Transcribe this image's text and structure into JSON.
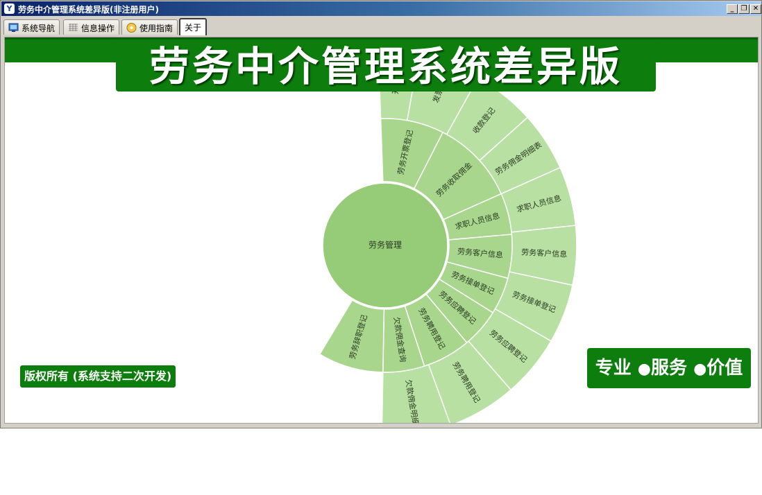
{
  "window": {
    "title": "劳务中介管理系统差异版(非注册用户)",
    "app_icon_glyph": "Y",
    "minimize_glyph": "_",
    "restore_glyph": "❐",
    "close_glyph": "✕"
  },
  "tabs": [
    {
      "label": "系统导航",
      "icon": "monitor-icon"
    },
    {
      "label": "信息操作",
      "icon": "grid-icon"
    },
    {
      "label": "使用指南",
      "icon": "help-disc-icon"
    },
    {
      "label": "关于",
      "icon": "",
      "active": true
    }
  ],
  "header": {
    "title": "劳务中介管理系统差异版"
  },
  "copyright": "版权所有 (系统支持二次开发)",
  "slogan": {
    "item1": "专业",
    "item2": "服务",
    "item3": "价值",
    "bullet": "●"
  },
  "colors": {
    "brand_green": "#0d7d0d",
    "core_green": "#96cb78",
    "ring1_green": "#a9d68d",
    "ring2_green": "#b8e0a2"
  },
  "sunburst": {
    "center": "劳务管理",
    "ring1": [
      "劳务开票登记",
      "劳务收取佣金",
      "求职人员信息",
      "劳务客户信息",
      "劳务接单登记",
      "劳务应聘登记",
      "劳务聘用登记",
      "欠款佣金查询",
      "劳务辞职登记"
    ],
    "ring2": [
      "开票",
      "发票",
      "收款登记",
      "劳务佣金明细表",
      "求职人员信息",
      "劳务客户信息",
      "劳务接单登记",
      "劳务应聘登记",
      "劳务聘用登记",
      "欠款佣金明细"
    ]
  }
}
